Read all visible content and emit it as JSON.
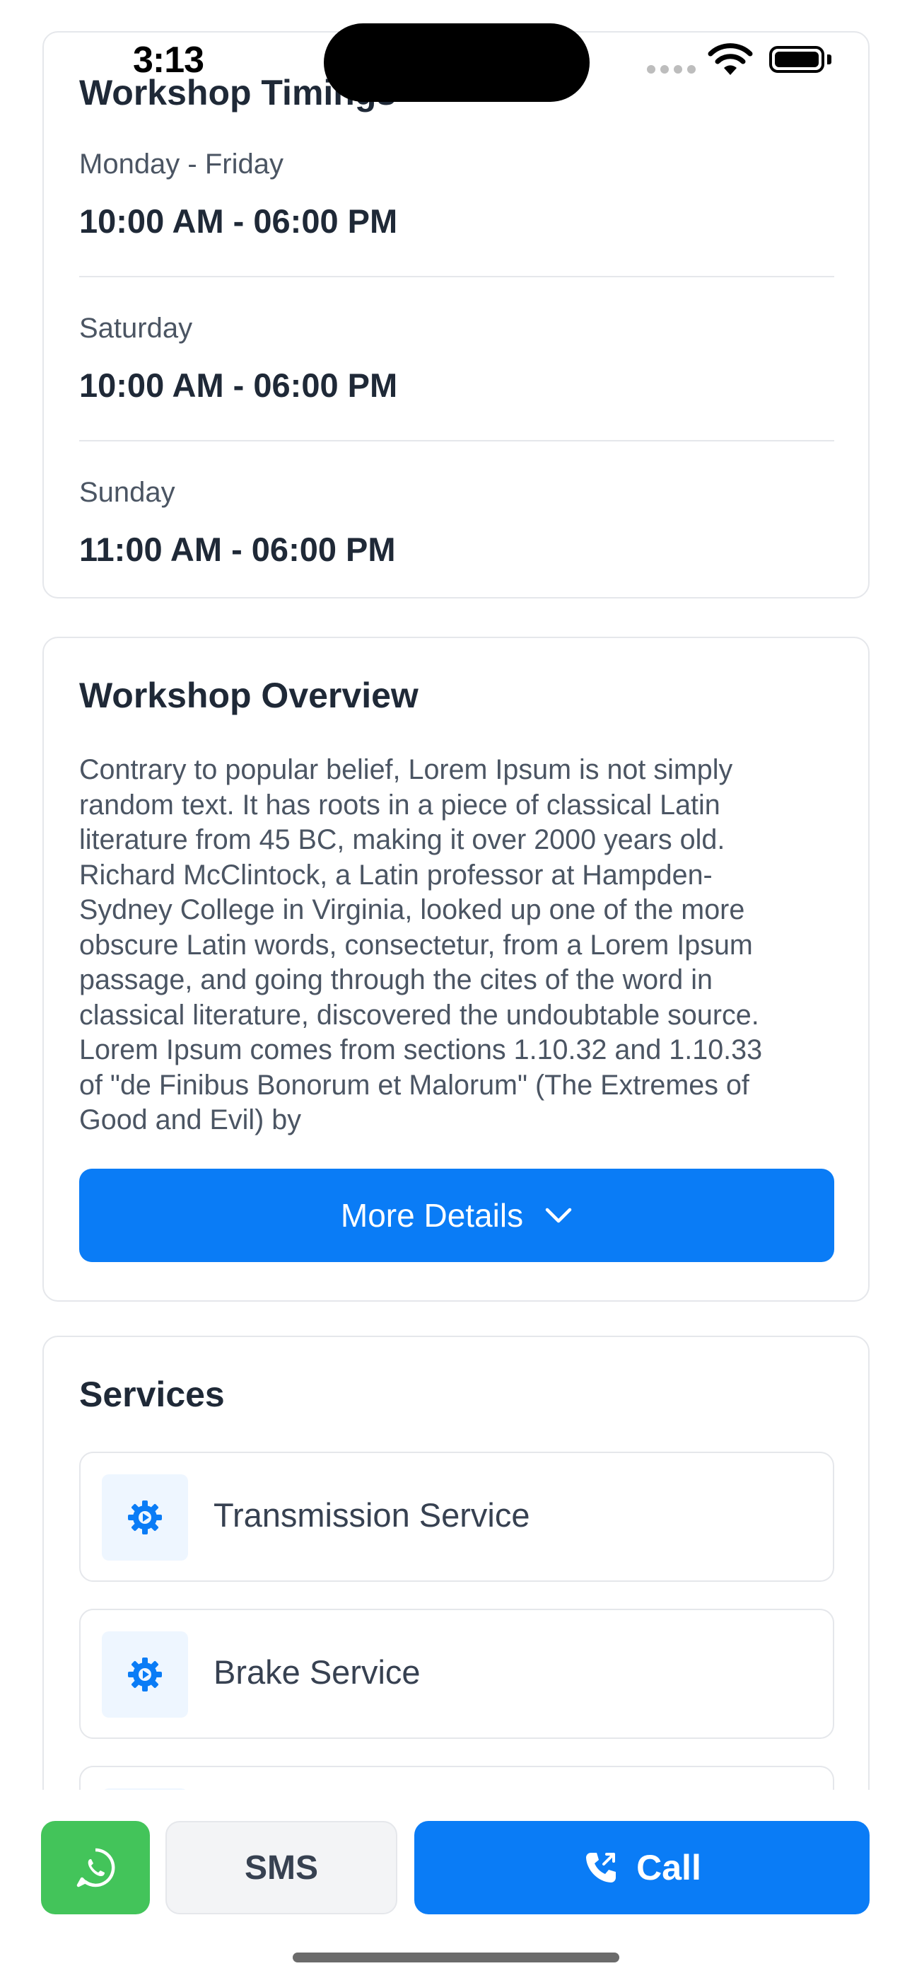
{
  "status_bar": {
    "time": "3:13"
  },
  "timings": {
    "title": "Workshop Timings",
    "rows": [
      {
        "day": "Monday - Friday",
        "hours": "10:00 AM - 06:00 PM"
      },
      {
        "day": "Saturday",
        "hours": "10:00 AM - 06:00 PM"
      },
      {
        "day": "Sunday",
        "hours": "11:00 AM - 06:00 PM"
      }
    ]
  },
  "overview": {
    "title": "Workshop Overview",
    "lines": [
      "Contrary to popular belief, Lorem Ipsum is not simply",
      "random text. It has roots in a piece of classical Latin",
      "literature from 45 BC, making it over 2000 years old.",
      "Richard McClintock, a Latin professor at Hampden-",
      "Sydney College in Virginia, looked up one of the more",
      "obscure Latin words, consectetur, from a Lorem Ipsum",
      "passage, and going through the cites of the word in",
      "classical literature, discovered the undoubtable source.",
      "Lorem Ipsum comes from sections 1.10.32 and 1.10.33",
      "of \"de Finibus Bonorum et Malorum\" (The Extremes of",
      "Good and Evil) by"
    ],
    "more_label": "More Details"
  },
  "services": {
    "title": "Services",
    "items": [
      {
        "label": "Transmission Service",
        "icon": "gear-icon"
      },
      {
        "label": "Brake Service",
        "icon": "gear-icon"
      }
    ]
  },
  "bottom_bar": {
    "whatsapp_icon": "whatsapp-icon",
    "sms_label": "SMS",
    "call_label": "Call"
  },
  "colors": {
    "primary": "#0a7cf6",
    "whatsapp": "#43c45a",
    "border": "#e5e7eb"
  }
}
